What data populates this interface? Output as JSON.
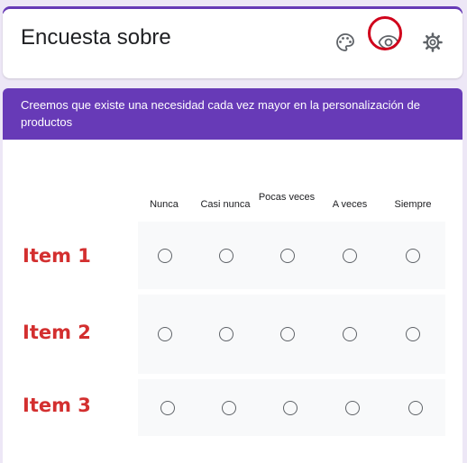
{
  "header": {
    "title": "Encuesta sobre",
    "icons": [
      "palette-icon",
      "eye-icon",
      "gear-icon"
    ]
  },
  "description": "Creemos que existe una necesidad cada vez mayor en la personalización de productos",
  "grid": {
    "columns": [
      "Nunca",
      "Casi nunca",
      "Pocas veces",
      "A veces",
      "Siempre"
    ],
    "rows": [
      "Item 1",
      "Item 2",
      "Item 3"
    ]
  },
  "colors": {
    "accent": "#673ab7",
    "background": "#ede7f6",
    "annotation": "#d32f2f"
  }
}
